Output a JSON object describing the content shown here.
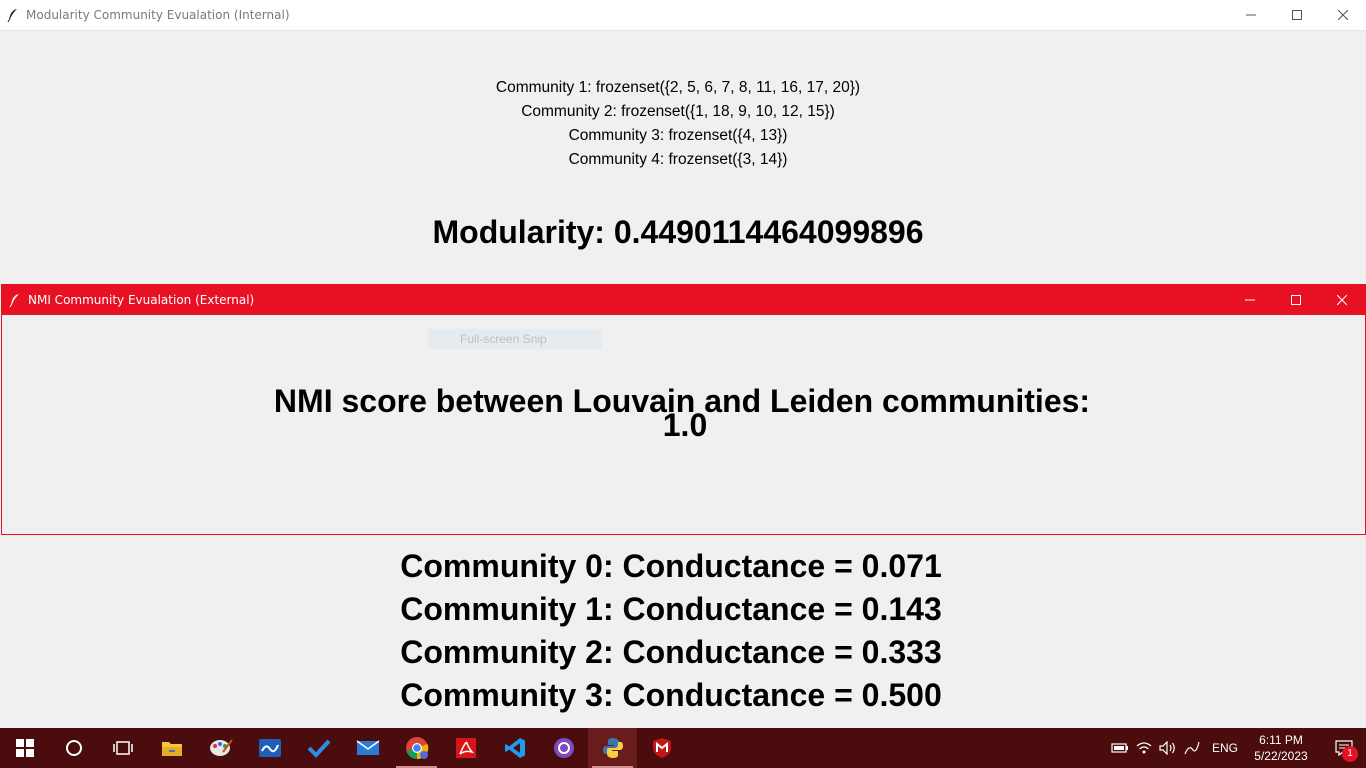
{
  "back_window": {
    "title": "Modularity Community Evualation (Internal)",
    "communities": [
      "Community 1: frozenset({2, 5, 6, 7, 8, 11, 16, 17, 20})",
      "Community 2: frozenset({1, 18, 9, 10, 12, 15})",
      "Community 3: frozenset({4, 13})",
      "Community 4: frozenset({3, 14})"
    ],
    "modularity": "Modularity: 0.4490114464099896",
    "conductance": [
      "Community 0: Conductance = 0.071",
      "Community 1: Conductance = 0.143",
      "Community 2: Conductance = 0.333",
      "Community 3: Conductance = 0.500"
    ]
  },
  "front_window": {
    "title": "NMI Community Evualation (External)",
    "snip_label": "Full-screen Snip",
    "nmi_heading": "NMI score between Louvain and Leiden communities:",
    "nmi_value": "1.0"
  },
  "taskbar": {
    "apps": [
      "start",
      "cortana-search",
      "task-view",
      "file-explorer",
      "paint",
      "whiteboard",
      "todo",
      "mail",
      "chrome",
      "acrobat",
      "vscode",
      "github-desktop",
      "python",
      "mcafee"
    ],
    "language": "ENG",
    "time": "6:11 PM",
    "date": "5/22/2023",
    "notification_count": "1"
  },
  "colors": {
    "accent_red": "#e81123",
    "taskbar_bg": "#4a0c0c",
    "window_bg": "#f0f0f0"
  }
}
